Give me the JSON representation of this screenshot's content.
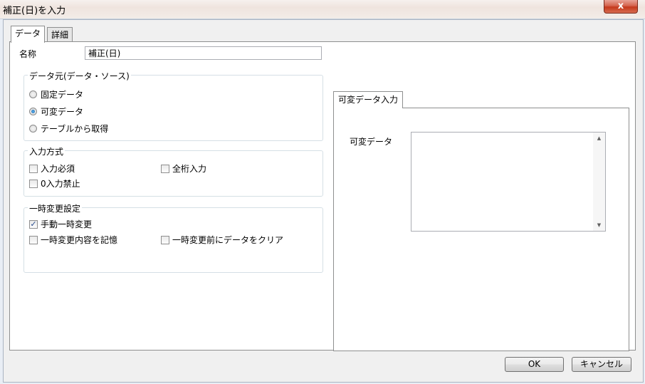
{
  "window": {
    "title": "補正(日)を入力",
    "close_label": "x"
  },
  "tabs": [
    {
      "label": "データ",
      "active": true
    },
    {
      "label": "詳細",
      "active": false
    }
  ],
  "name_field": {
    "label": "名称",
    "value": "補正(日)"
  },
  "data_source": {
    "legend": "データ元(データ・ソース)",
    "options": [
      {
        "label": "固定データ",
        "selected": false
      },
      {
        "label": "可変データ",
        "selected": true
      },
      {
        "label": "テーブルから取得",
        "selected": false
      }
    ]
  },
  "input_method": {
    "legend": "入力方式",
    "options": [
      {
        "label": "入力必須",
        "checked": false
      },
      {
        "label": "全桁入力",
        "checked": false
      },
      {
        "label": "0入力禁止",
        "checked": false
      }
    ]
  },
  "temp_change": {
    "legend": "一時変更設定",
    "options": [
      {
        "label": "手動一時変更",
        "checked": true
      },
      {
        "label": "一時変更内容を記憶",
        "checked": false
      },
      {
        "label": "一時変更前にデータをクリア",
        "checked": false
      }
    ]
  },
  "variable_panel": {
    "tab_label": "可変データ入力",
    "field_label": "可変データ",
    "value": ""
  },
  "buttons": {
    "ok": "OK",
    "cancel": "キャンセル"
  }
}
